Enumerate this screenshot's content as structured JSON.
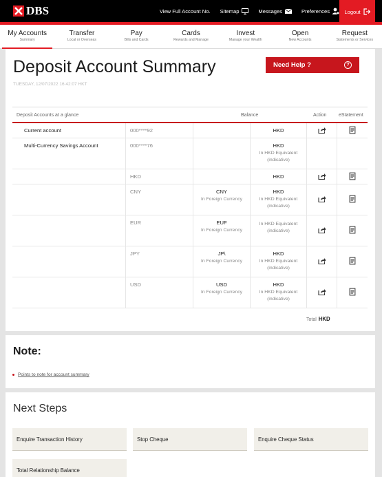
{
  "header": {
    "brand": "DBS",
    "links": [
      "View Full Account No.",
      "Sitemap",
      "Messages",
      "Preferences"
    ],
    "logout": "Logout"
  },
  "nav": [
    {
      "label": "My Accounts",
      "sub": "Summary",
      "active": true
    },
    {
      "label": "Transfer",
      "sub": "Local or Overseas"
    },
    {
      "label": "Pay",
      "sub": "Bills and Cards"
    },
    {
      "label": "Cards",
      "sub": "Rewards and Manage"
    },
    {
      "label": "Invest",
      "sub": "Manage your Wealth"
    },
    {
      "label": "Open",
      "sub": "New Accounts"
    },
    {
      "label": "Request",
      "sub": "Statements or Services"
    }
  ],
  "page": {
    "title": "Deposit Account Summary",
    "date": "TUESDAY, 12/07/2022 16:42:07 HKT",
    "help": "Need Help ?",
    "help_icon": "?"
  },
  "table": {
    "headers": {
      "accounts": "Deposit Accounts at a glance",
      "balance": "Balance",
      "action": "Action",
      "estatement": "eStatement"
    },
    "rows": [
      {
        "name": "Current account",
        "number": "000****92",
        "foreign": "",
        "foreign_sub": "",
        "hkd": "HKD",
        "hkd_sub": ""
      },
      {
        "name": "Multi-Currency Savings Account",
        "number": "000****76",
        "foreign": "",
        "foreign_sub": "",
        "hkd": "HKD",
        "hkd_sub": "In HKD Equivalent (indicative)"
      },
      {
        "name": "",
        "number": "HKD",
        "foreign": "",
        "foreign_sub": "",
        "hkd": "HKD",
        "hkd_sub": ""
      },
      {
        "name": "",
        "number": "CNY",
        "foreign": "CNY",
        "foreign_sub": "In Foreign Currency",
        "hkd": "HKD",
        "hkd_sub": "In HKD Equivalent (indicative)"
      },
      {
        "name": "",
        "number": "EUR",
        "foreign": "EUF",
        "foreign_sub": "In Foreign Currency",
        "hkd": "",
        "hkd_sub": "In HKD Equivalent (indicative)"
      },
      {
        "name": "",
        "number": "JPY",
        "foreign": "JP\\",
        "foreign_sub": "In Foreign Currency",
        "hkd": "HKD",
        "hkd_sub": "In HKD Equivalent (indicative)"
      },
      {
        "name": "",
        "number": "USD",
        "foreign": "USD",
        "foreign_sub": "In Foreign Currency",
        "hkd": "HKD",
        "hkd_sub": "In HKD Equivalent (indicative)"
      }
    ],
    "total_label": "Total",
    "total_value": "HKD"
  },
  "note": {
    "title": "Note:",
    "link": "Points to note for account summary"
  },
  "next_steps": {
    "title": "Next Steps",
    "items": [
      "Enquire Transaction History",
      "Stop Cheque",
      "Enquire Cheque Status",
      "Total Relationship Balance"
    ]
  }
}
